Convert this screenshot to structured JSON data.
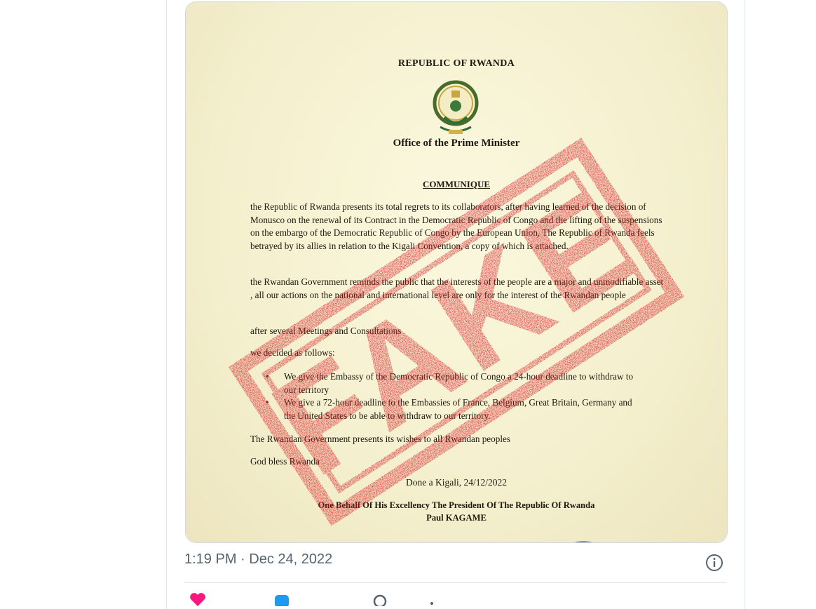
{
  "tweet": {
    "timestamp": "1:19 PM · Dec 24, 2022"
  },
  "document": {
    "header": "REPUBLIC OF RWANDA",
    "office": "Office of the Prime Minister",
    "heading": "COMMUNIQUE",
    "paragraph1": "the Republic of Rwanda presents its total regrets to its collaborators, after having learned of the decision of Monusco on the renewal of its Contract in the Democratic Republic of Congo and the lifting of the suspensions on the embargo of the Democratic Republic of Congo by the European Union, The Republic of Rwanda feels betrayed by its allies in relation to the Kigali Convention, a copy of which is attached.",
    "paragraph2": "the Rwandan Government reminds the public that the interests of the people are a major and unmodifiable asset , all our actions on the national and international level are only for the interest of the Rwandan people",
    "paragraph3": "after several Meetings and Consultations",
    "paragraph4": "we decided as follows:",
    "bullet1": "We give the Embassy of the Democratic Republic of Congo a 24-hour deadline to withdraw to our territory",
    "bullet2": "We give a 72-hour deadline to the Embassies of France, Belgium, Great Britain, Germany and the United States to be able to withdraw to our territory.",
    "paragraph5": "The Rwandan Government presents its wishes to all Rwandan peoples",
    "paragraph6": "God bless Rwanda",
    "done": "Done a Kigali, 24/12/2022",
    "behalf": "One Behalf Of His Excellency The President Of The Republic Of Rwanda",
    "signatory": "Paul KAGAME"
  },
  "overlay": {
    "stamp_text": "FAKE",
    "stamp_color": "#d9232b"
  },
  "icons": {
    "info": "info-icon",
    "like": "heart-icon",
    "reply": "reply-icon",
    "share": "share-icon"
  },
  "colors": {
    "like": "#f91880",
    "reply": "#1d9bf0",
    "meta_text": "#536471"
  }
}
